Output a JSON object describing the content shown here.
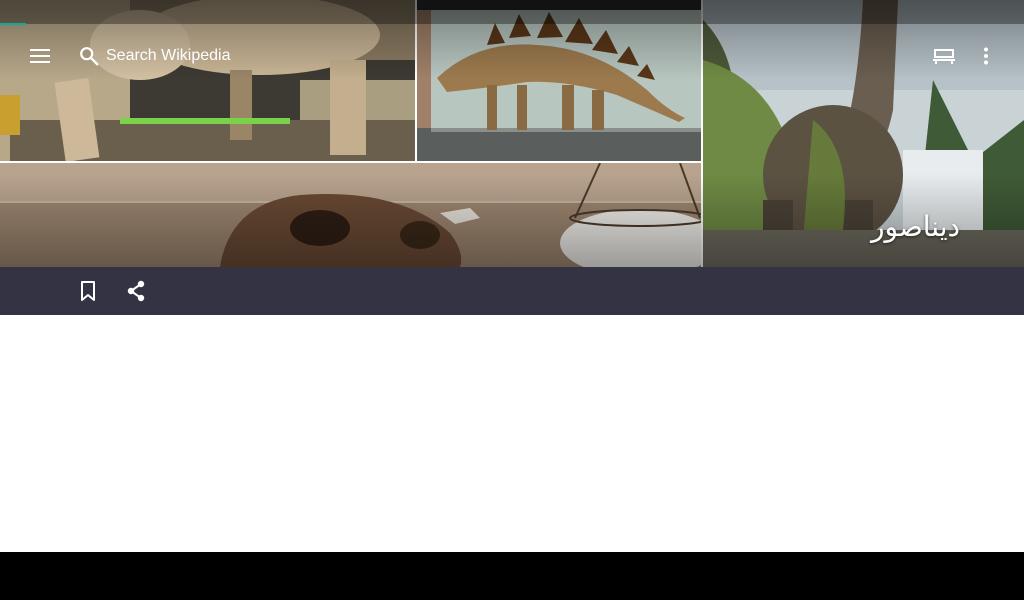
{
  "toolbar": {
    "search_placeholder": "Search Wikipedia"
  },
  "article": {
    "title": "ديناصور"
  },
  "icons": {
    "menu": "menu-icon",
    "search": "search-icon",
    "reading_lists": "reading-lists-icon",
    "overflow": "more-vert-icon",
    "bookmark": "bookmark-icon",
    "share": "share-icon"
  },
  "colors": {
    "action_bar": "#333344",
    "progress": "#14a89a",
    "content_bg": "#ffffff"
  }
}
